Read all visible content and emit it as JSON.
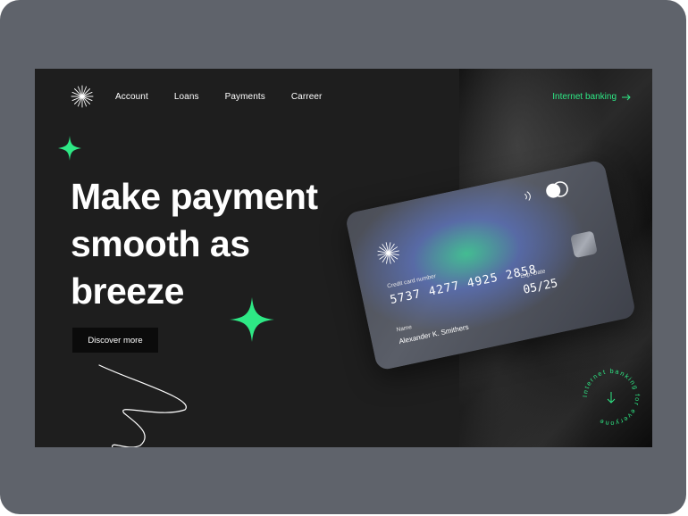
{
  "nav": {
    "items": [
      {
        "label": "Account"
      },
      {
        "label": "Loans"
      },
      {
        "label": "Payments"
      },
      {
        "label": "Carreer"
      }
    ],
    "internet_banking_label": "Internet banking",
    "logo_icon": "starburst-icon",
    "arrow_icon": "arrow-right-icon"
  },
  "hero": {
    "headline_line1": "Make payment",
    "headline_line2": "smooth as",
    "headline_line3": "breeze",
    "cta_label": "Discover more"
  },
  "card": {
    "number_label": "Credit card number",
    "number": "5737  4277  4925  2858",
    "exp_label": "Exp. Date",
    "exp_value": "05/25",
    "name_label": "Name",
    "name_value": "Alexander K. Smithers"
  },
  "badge": {
    "text": "Internet banking for everyone",
    "icon": "arrow-down-icon"
  },
  "colors": {
    "accent": "#2ee885",
    "background": "#1e1e1e",
    "frame": "#5f636b"
  }
}
